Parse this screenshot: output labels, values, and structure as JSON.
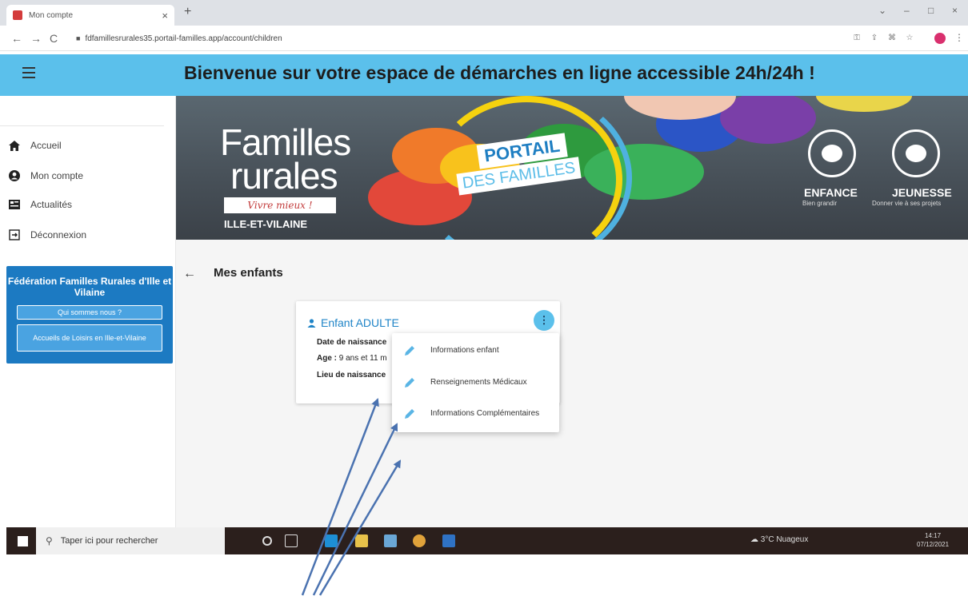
{
  "browser": {
    "tab_title": "Mon compte",
    "tab_close": "×",
    "new_tab": "+",
    "url": "fdfamillesrurales35.portail-familles.app/account/children",
    "nav_back": "←",
    "nav_forward": "→",
    "nav_reload": "C",
    "window_minimize": "–",
    "window_maximize": "□",
    "window_close": "×",
    "menu": "⋮"
  },
  "header": {
    "welcome": "Bienvenue sur votre espace de démarches en ligne accessible 24h/24h !",
    "color": "#5bc0eb"
  },
  "sidebar": {
    "items": [
      {
        "label": "Accueil",
        "icon": "home-icon"
      },
      {
        "label": "Mon compte",
        "icon": "account-icon"
      },
      {
        "label": "Actualités",
        "icon": "news-icon"
      },
      {
        "label": "Déconnexion",
        "icon": "logout-icon"
      }
    ],
    "federation": {
      "title": "Fédération Familles Rurales d'Ille et Vilaine",
      "buttons": [
        "Qui sommes nous ?",
        "Accueils de Loisirs en Ille-et-Vilaine"
      ],
      "color": "#1c7ac2"
    }
  },
  "banner": {
    "logo_line1": "Familles",
    "logo_line2": "rurales",
    "logo_slogan": "Vivre mieux !",
    "logo_region": "ILLE-ET-VILAINE",
    "portail_line1": "PORTAIL",
    "portail_line2": "DES FAMILLES",
    "enfance_title": "ENFANCE",
    "enfance_sub": "Bien grandir",
    "jeunesse_title": "JEUNESSE",
    "jeunesse_sub": "Donner vie à ses projets"
  },
  "main": {
    "back": "←",
    "title": "Mes enfants",
    "card": {
      "name": "Enfant ADULTE",
      "birth_label": "Date de naissance",
      "age_label": "Age :",
      "age_value": "9 ans et 11 m",
      "place_label": "Lieu de naissance"
    },
    "menu": [
      "Informations enfant",
      "Renseignements Médicaux",
      "Informations Complémentaires"
    ]
  },
  "taskbar": {
    "search_placeholder": "Taper ici pour rechercher",
    "weather": "3°C Nuageux",
    "time": "14:17",
    "date": "07/12/2021"
  }
}
